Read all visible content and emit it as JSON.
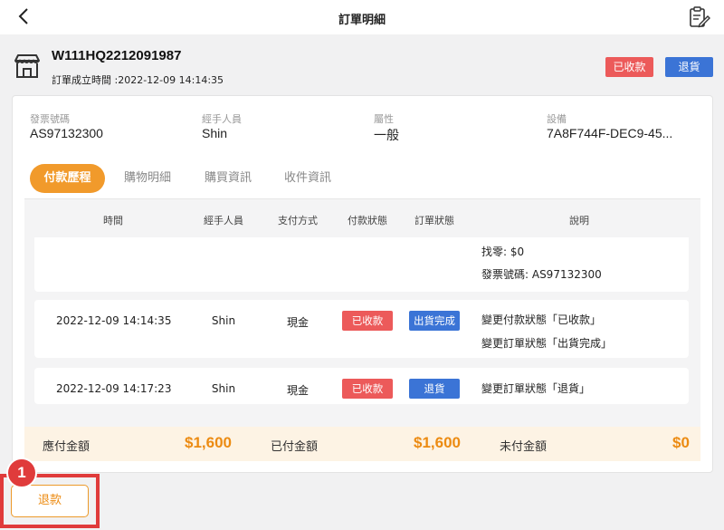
{
  "header": {
    "title": "訂單明細",
    "back_icon": "chevron-left-icon",
    "note_icon": "clipboard-edit-icon"
  },
  "order": {
    "store_icon": "store-icon",
    "number": "W111HQ2212091987",
    "created_time": "訂單成立時間 :2022-12-09  14:14:35",
    "status_received": "已收款",
    "status_return": "退貨"
  },
  "info": [
    {
      "label": "發票號碼",
      "value": "AS97132300"
    },
    {
      "label": "經手人員",
      "value": "Shin"
    },
    {
      "label": "屬性",
      "value": "一般"
    },
    {
      "label": "設備",
      "value": "7A8F744F-DEC9-45..."
    }
  ],
  "tabs": [
    "付款歷程",
    "購物明細",
    "購買資訊",
    "收件資訊"
  ],
  "active_tab": "付款歷程",
  "table": {
    "headers": [
      "時間",
      "經手人員",
      "支付方式",
      "付款狀態",
      "訂單狀態",
      "說明"
    ],
    "partial_row": {
      "notes": [
        "找零: $0",
        "發票號碼: AS97132300"
      ]
    },
    "rows": [
      {
        "time": "2022-12-09  14:14:35",
        "staff": "Shin",
        "method": "現金",
        "pay_status": "已收款",
        "order_status": "出貨完成",
        "notes": [
          "變更付款狀態「已收款」",
          "變更訂單狀態「出貨完成」"
        ]
      },
      {
        "time": "2022-12-09  14:17:23",
        "staff": "Shin",
        "method": "現金",
        "pay_status": "已收款",
        "order_status": "退貨",
        "notes": [
          "變更訂單狀態「退貨」"
        ]
      }
    ]
  },
  "summary": {
    "payable_label": "應付金額",
    "payable_value": "$1,600",
    "paid_label": "已付金額",
    "paid_value": "$1,600",
    "unpaid_label": "未付金額",
    "unpaid_value": "$0"
  },
  "actions": {
    "refund_label": "退款",
    "step_number": "1"
  },
  "colors": {
    "accent_orange": "#f19a2b",
    "status_red": "#ec5a5a",
    "status_blue": "#3b74d6",
    "highlight_red": "#e03b3b"
  }
}
